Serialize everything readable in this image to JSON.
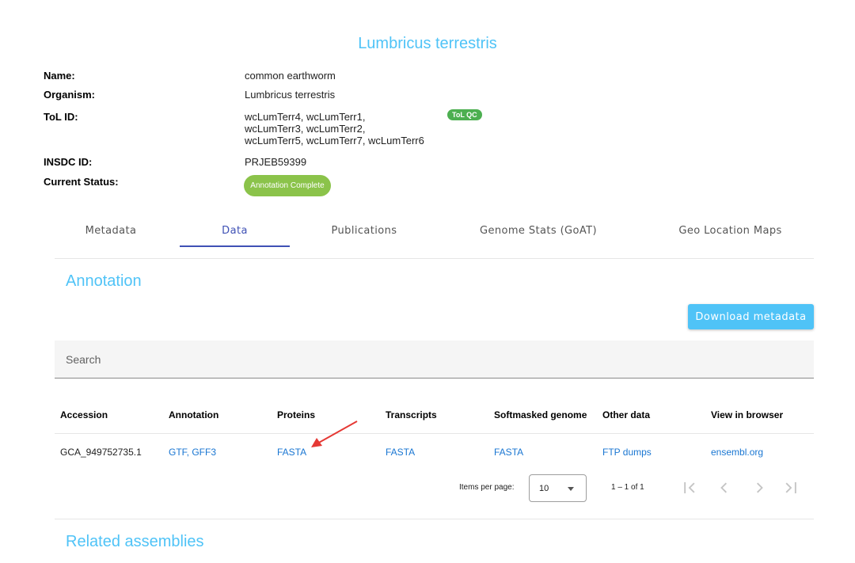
{
  "header": {
    "title": "Lumbricus terrestris"
  },
  "metadata": {
    "name_label": "Name:",
    "name_value": "common earthworm",
    "organism_label": "Organism:",
    "organism_value": "Lumbricus terrestris",
    "tolid_label": "ToL ID:",
    "tolid_lines": [
      "wcLumTerr4, wcLumTerr1,",
      "wcLumTerr3, wcLumTerr2,",
      "wcLumTerr5, wcLumTerr7, wcLumTerr6"
    ],
    "tolqc_badge": "ToL QC",
    "insdc_label": "INSDC ID:",
    "insdc_value": "PRJEB59399",
    "status_label": "Current Status:",
    "status_value": "Annotation Complete",
    "status_color": "#8bc34a"
  },
  "tabs": [
    {
      "label": "Metadata"
    },
    {
      "label": "Data",
      "active": true
    },
    {
      "label": "Publications"
    },
    {
      "label": "Genome Stats (GoAT)"
    },
    {
      "label": "Geo Location Maps"
    }
  ],
  "annotation": {
    "section_title": "Annotation",
    "download_label": "Download metadata",
    "search_placeholder": "Search",
    "columns": [
      "Accession",
      "Annotation",
      "Proteins",
      "Transcripts",
      "Softmasked genome",
      "Other data",
      "View in browser"
    ],
    "rows": [
      {
        "accession": "GCA_949752735.1",
        "annotation": "GTF, GFF3",
        "proteins": "FASTA",
        "transcripts": "FASTA",
        "softmasked": "FASTA",
        "other": "FTP dumps",
        "browser": "ensembl.org"
      }
    ],
    "paginator": {
      "items_per_page_label": "Items per page:",
      "page_size": "10",
      "range": "1 – 1 of 1",
      "first_icon": "first-page-icon",
      "prev_icon": "chevron-left-icon",
      "next_icon": "chevron-right-icon",
      "last_icon": "last-page-icon"
    }
  },
  "related": {
    "section_title": "Related assemblies"
  },
  "colors": {
    "accent": "#4fc3f7",
    "link": "#1976d2",
    "tab_indicator": "#3f51b5",
    "annotation_arrow": "#e53935"
  }
}
